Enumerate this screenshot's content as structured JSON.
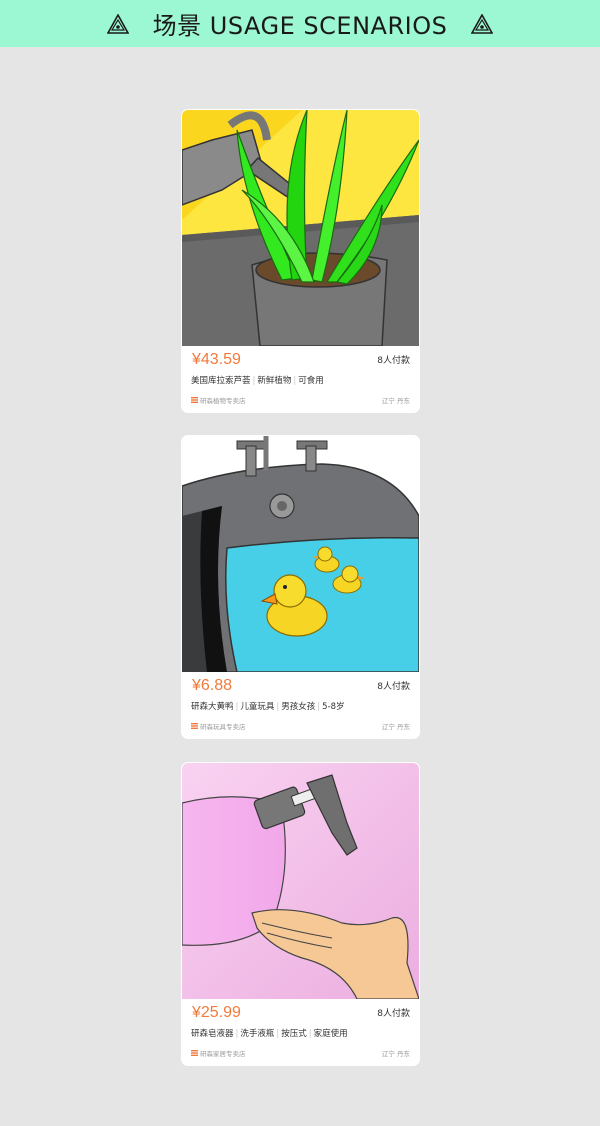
{
  "header": {
    "title": "场景 USAGE SCENARIOS",
    "left_icon": "triangle-eye-icon",
    "right_icon": "triangle-eye-icon",
    "background_color": "#9cf7d3"
  },
  "products": [
    {
      "image": "aloe-plant-watering-image",
      "price": "¥43.59",
      "pay_count": "8人付款",
      "title_parts": [
        "美国库拉索芦荟",
        "新鲜植物",
        "可食用"
      ],
      "store": "研森植物专卖店",
      "location": "辽宁 丹东"
    },
    {
      "image": "rubber-ducks-bathtub-image",
      "price": "¥6.88",
      "pay_count": "8人付款",
      "title_parts": [
        "研森大黄鸭",
        "儿童玩具",
        "男孩女孩",
        "5-8岁"
      ],
      "store": "研森玩具专卖店",
      "location": "辽宁 丹东"
    },
    {
      "image": "soap-dispenser-hand-image",
      "price": "¥25.99",
      "pay_count": "8人付款",
      "title_parts": [
        "研森皂液器",
        "洗手液瓶",
        "按压式",
        "家庭使用"
      ],
      "store": "研森家居专卖店",
      "location": "辽宁 丹东"
    }
  ],
  "colors": {
    "price": "#f07a3a",
    "page_background": "#e5e5e5",
    "store_icon": "#f07a3a"
  }
}
